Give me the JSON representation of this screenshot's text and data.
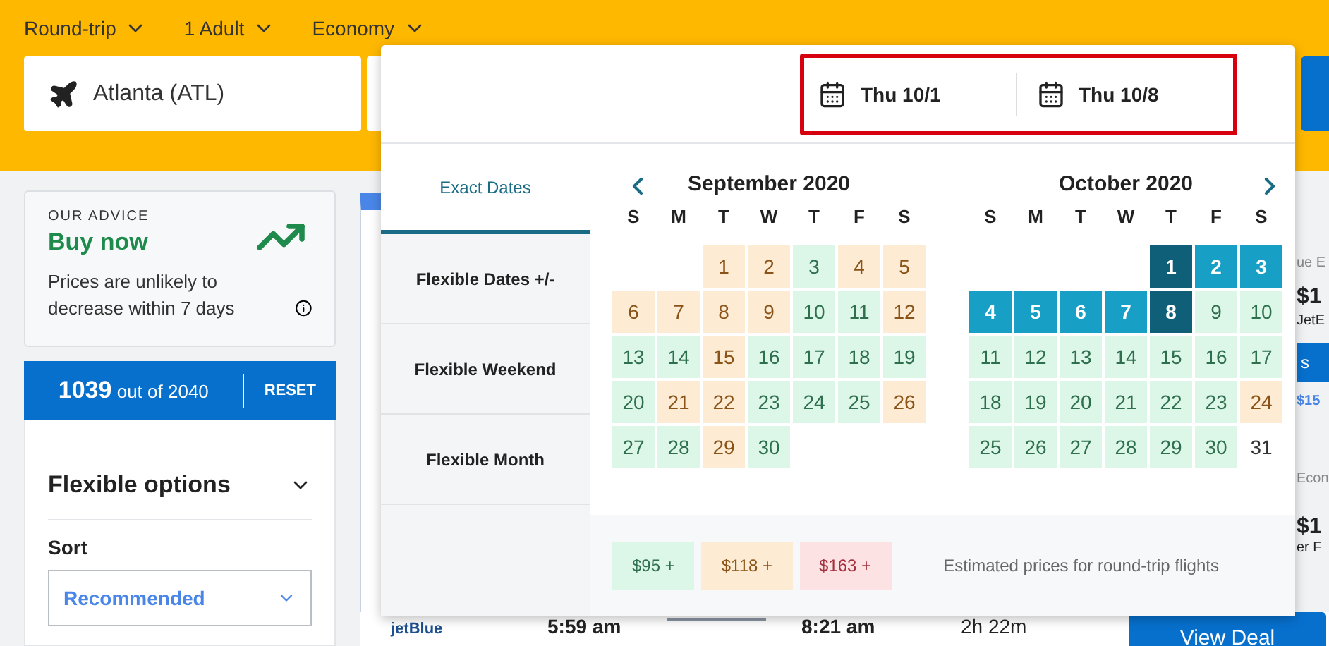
{
  "top_options": [
    {
      "label": "Round-trip"
    },
    {
      "label": "1 Adult"
    },
    {
      "label": "Economy"
    }
  ],
  "origin": {
    "value": "Atlanta (ATL)"
  },
  "advice": {
    "eyebrow": "OUR ADVICE",
    "verdict": "Buy now",
    "text": "Prices are unlikely to decrease within 7 days"
  },
  "results_count": {
    "shown": "1039",
    "total": "out of 2040",
    "reset": "RESET"
  },
  "filters": {
    "title": "Flexible options",
    "expanded": true,
    "sort_label": "Sort",
    "sort_value": "Recommended"
  },
  "date_picker": {
    "dates": [
      {
        "label": "Thu 10/1"
      },
      {
        "label": "Thu 10/8"
      }
    ],
    "tabs": [
      {
        "label": "Exact Dates",
        "selected": true
      },
      {
        "label": "Flexible Dates +/-",
        "selected": false
      },
      {
        "label": "Flexible Weekend",
        "selected": false
      },
      {
        "label": "Flexible Month",
        "selected": false
      }
    ],
    "months": [
      {
        "title": "September 2020",
        "weekdays": [
          "S",
          "M",
          "T",
          "W",
          "T",
          "F",
          "S"
        ],
        "days": [
          {
            "kind": "blank"
          },
          {
            "kind": "blank"
          },
          {
            "day": "1",
            "kind": "mid"
          },
          {
            "day": "2",
            "kind": "mid"
          },
          {
            "day": "3",
            "kind": "low"
          },
          {
            "day": "4",
            "kind": "mid"
          },
          {
            "day": "5",
            "kind": "mid"
          },
          {
            "day": "6",
            "kind": "mid"
          },
          {
            "day": "7",
            "kind": "mid"
          },
          {
            "day": "8",
            "kind": "mid"
          },
          {
            "day": "9",
            "kind": "mid"
          },
          {
            "day": "10",
            "kind": "low"
          },
          {
            "day": "11",
            "kind": "low"
          },
          {
            "day": "12",
            "kind": "mid"
          },
          {
            "day": "13",
            "kind": "low"
          },
          {
            "day": "14",
            "kind": "low"
          },
          {
            "day": "15",
            "kind": "mid"
          },
          {
            "day": "16",
            "kind": "low"
          },
          {
            "day": "17",
            "kind": "low"
          },
          {
            "day": "18",
            "kind": "low"
          },
          {
            "day": "19",
            "kind": "low"
          },
          {
            "day": "20",
            "kind": "low"
          },
          {
            "day": "21",
            "kind": "mid"
          },
          {
            "day": "22",
            "kind": "mid"
          },
          {
            "day": "23",
            "kind": "low"
          },
          {
            "day": "24",
            "kind": "low"
          },
          {
            "day": "25",
            "kind": "low"
          },
          {
            "day": "26",
            "kind": "mid"
          },
          {
            "day": "27",
            "kind": "low"
          },
          {
            "day": "28",
            "kind": "low"
          },
          {
            "day": "29",
            "kind": "mid"
          },
          {
            "day": "30",
            "kind": "low"
          }
        ]
      },
      {
        "title": "October 2020",
        "weekdays": [
          "S",
          "M",
          "T",
          "W",
          "T",
          "F",
          "S"
        ],
        "days": [
          {
            "kind": "blank"
          },
          {
            "kind": "blank"
          },
          {
            "kind": "blank"
          },
          {
            "kind": "blank"
          },
          {
            "day": "1",
            "kind": "endpoint"
          },
          {
            "day": "2",
            "kind": "range"
          },
          {
            "day": "3",
            "kind": "range"
          },
          {
            "day": "4",
            "kind": "range"
          },
          {
            "day": "5",
            "kind": "range"
          },
          {
            "day": "6",
            "kind": "range"
          },
          {
            "day": "7",
            "kind": "range"
          },
          {
            "day": "8",
            "kind": "endpoint"
          },
          {
            "day": "9",
            "kind": "low"
          },
          {
            "day": "10",
            "kind": "low"
          },
          {
            "day": "11",
            "kind": "low"
          },
          {
            "day": "12",
            "kind": "low"
          },
          {
            "day": "13",
            "kind": "low"
          },
          {
            "day": "14",
            "kind": "low"
          },
          {
            "day": "15",
            "kind": "low"
          },
          {
            "day": "16",
            "kind": "low"
          },
          {
            "day": "17",
            "kind": "low"
          },
          {
            "day": "18",
            "kind": "low"
          },
          {
            "day": "19",
            "kind": "low"
          },
          {
            "day": "20",
            "kind": "low"
          },
          {
            "day": "21",
            "kind": "low"
          },
          {
            "day": "22",
            "kind": "low"
          },
          {
            "day": "23",
            "kind": "low"
          },
          {
            "day": "24",
            "kind": "mid"
          },
          {
            "day": "25",
            "kind": "low"
          },
          {
            "day": "26",
            "kind": "low"
          },
          {
            "day": "27",
            "kind": "low"
          },
          {
            "day": "28",
            "kind": "low"
          },
          {
            "day": "29",
            "kind": "low"
          },
          {
            "day": "30",
            "kind": "low"
          },
          {
            "day": "31",
            "kind": "none"
          }
        ]
      }
    ],
    "legend": [
      {
        "label": "$95 +",
        "kind": "low"
      },
      {
        "label": "$118 +",
        "kind": "mid"
      },
      {
        "label": "$163 +",
        "kind": "high"
      }
    ],
    "note": "Estimated prices for round-trip flights"
  },
  "side_card_fragments": {
    "provider": "ue E",
    "price": "$1",
    "airline": "JetE",
    "button": "s",
    "alt_price": "$15",
    "cabin": "Econ",
    "price_2": "$1",
    "caption": "er F"
  },
  "flight": {
    "airline": "jetBlue",
    "depart": "5:59 am",
    "arrive": "8:21 am",
    "duration": "2h 22m",
    "action": "View Deal"
  }
}
